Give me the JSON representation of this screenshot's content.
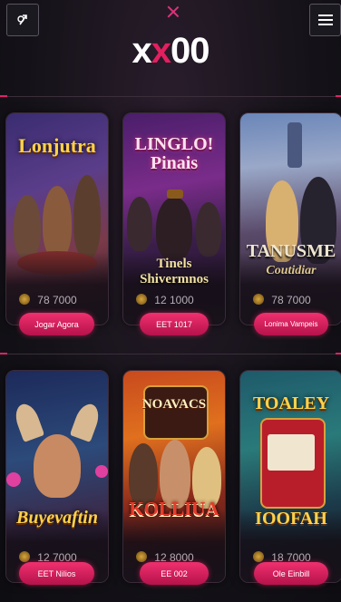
{
  "header": {
    "logo_part1": "x",
    "logo_part2": "x",
    "logo_part3": "00",
    "left_icon": "exit-icon",
    "menu_icon": "hamburger-menu-icon",
    "close_icon": "close-icon"
  },
  "colors": {
    "accent": "#e2205f",
    "background": "#15131a"
  },
  "games": [
    {
      "title": "Lonjutra",
      "subtitle": "",
      "amount": "78 7000",
      "button": "Jogar Agora"
    },
    {
      "title": "LINGLO! Pinais",
      "subtitle": "Tinels Shivermnos",
      "amount": "12 1000",
      "button": "EET 1017"
    },
    {
      "title": "TANUSME",
      "subtitle": "Coutidiar",
      "amount": "78 7000",
      "button": "Lonima Vampeis"
    },
    {
      "title": "Buyevaftin",
      "subtitle": "",
      "amount": "12 7000",
      "button": "EET Nilios"
    },
    {
      "title": "NOAVACS",
      "subtitle": "KOLLIUA",
      "amount": "12 8000",
      "button": "EE 002"
    },
    {
      "title": "TOALEY",
      "subtitle": "IOOFAH",
      "amount": "18 7000",
      "button": "Ole Einbill"
    }
  ]
}
